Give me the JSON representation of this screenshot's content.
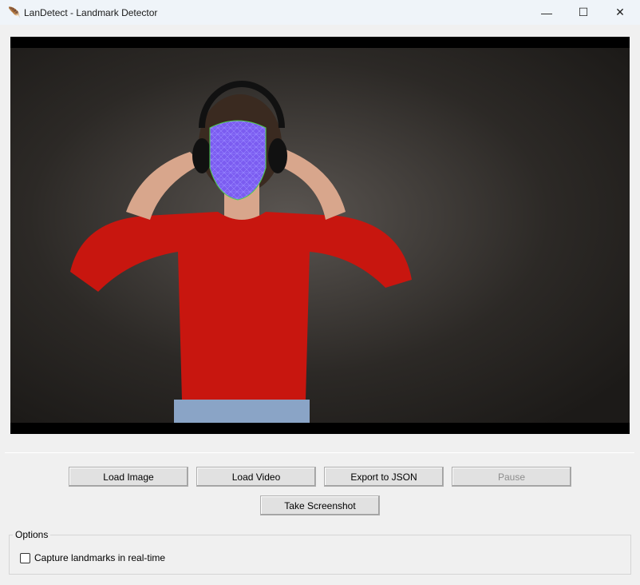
{
  "window": {
    "title": "LanDetect - Landmark Detector",
    "icon": "feather-icon",
    "minimize": "—",
    "maximize": "☐",
    "close": "✕"
  },
  "buttons": {
    "load_image": "Load Image",
    "load_video": "Load Video",
    "export_json": "Export to JSON",
    "pause": "Pause",
    "take_screenshot": "Take Screenshot"
  },
  "options": {
    "label": "Options",
    "realtime_checkbox": {
      "label": "Capture landmarks in real-time",
      "checked": false
    }
  },
  "colors": {
    "mesh": "#7b5cf0",
    "sweater": "#c8160f"
  }
}
